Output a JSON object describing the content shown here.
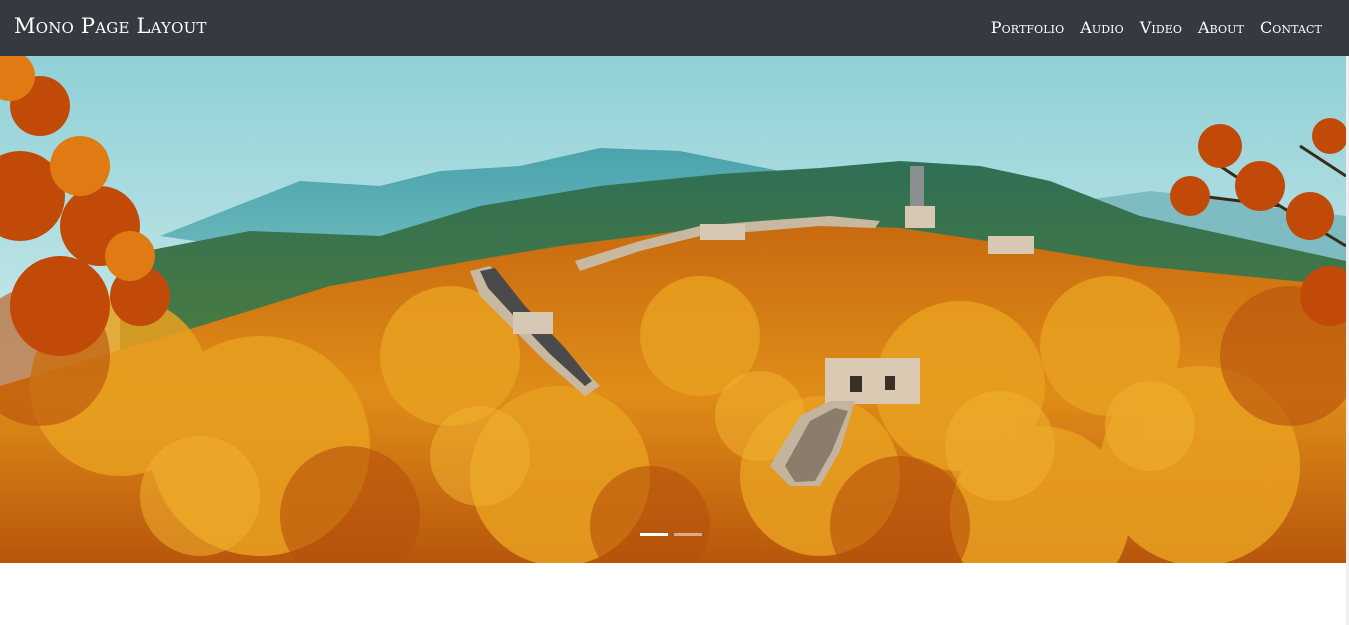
{
  "navbar": {
    "brand": "Mono Page Layout",
    "links": [
      "Portfolio",
      "Audio",
      "Video",
      "About",
      "Contact"
    ]
  },
  "carousel": {
    "image": "great-wall-autumn-landscape",
    "slides": 2,
    "active_slide": 1
  },
  "colors": {
    "navbar_bg": "#343a40",
    "nav_text": "#ffffff",
    "sky": "#9fd6dc",
    "foliage": "#e0901a"
  }
}
